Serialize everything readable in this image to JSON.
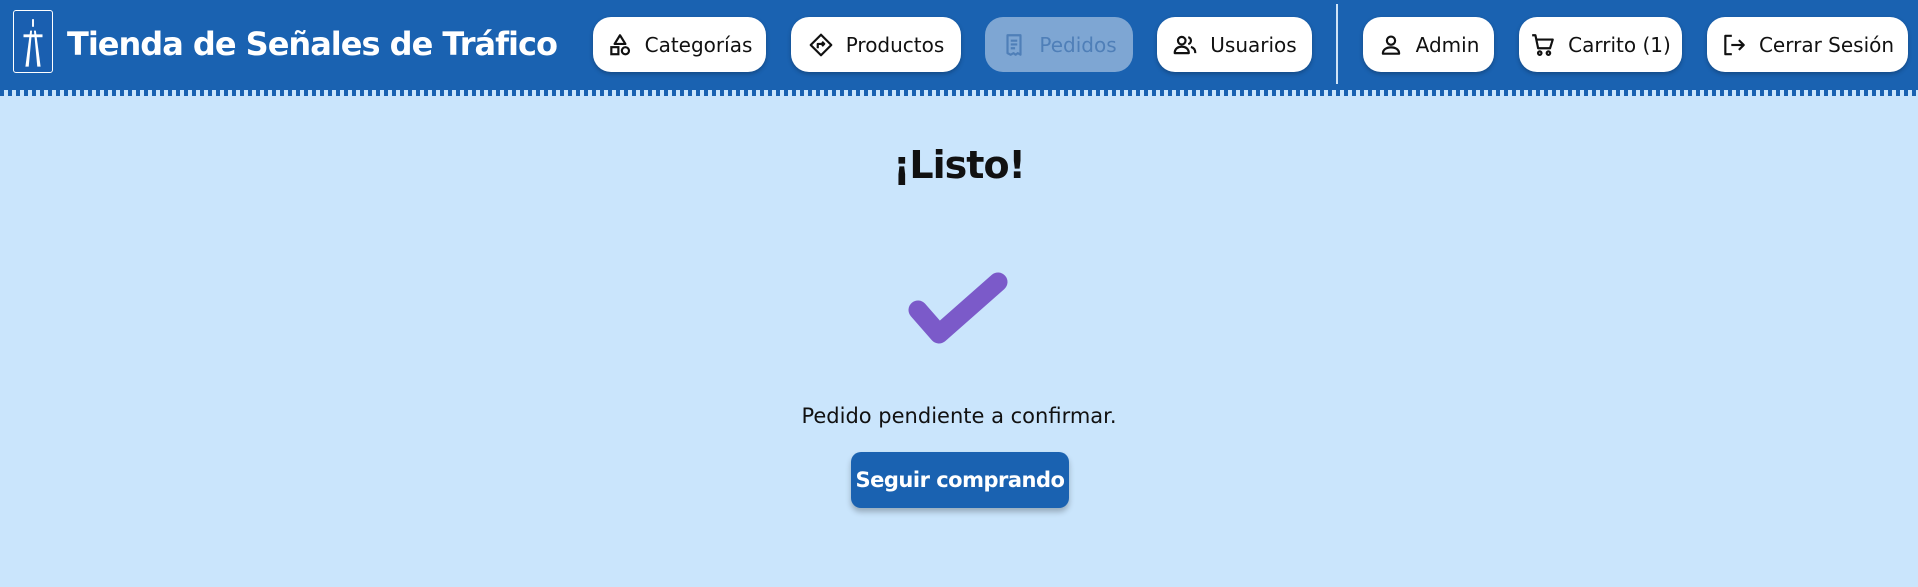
{
  "header": {
    "brand_title": "Tienda de Señales de Tráfico",
    "logo_icon": "motorway-sign-icon",
    "nav": [
      {
        "label": "Categorías",
        "icon": "shapes-icon",
        "state": "enabled"
      },
      {
        "label": "Productos",
        "icon": "direction-sign-icon",
        "state": "enabled"
      },
      {
        "label": "Pedidos",
        "icon": "receipt-icon",
        "state": "disabled"
      },
      {
        "label": "Usuarios",
        "icon": "users-icon",
        "state": "enabled"
      }
    ],
    "account": [
      {
        "label": "Admin",
        "icon": "person-icon"
      },
      {
        "label": "Carrito (1)",
        "icon": "cart-icon"
      },
      {
        "label": "Cerrar Sesión",
        "icon": "logout-icon"
      }
    ]
  },
  "main": {
    "title": "¡Listo!",
    "status_icon": "checkmark-icon",
    "message": "Pedido pendiente a confirmar.",
    "continue_button": "Seguir comprando"
  },
  "colors": {
    "primary": "#1a62b1",
    "background": "#cae5fc",
    "check": "#7b5ac9",
    "disabled_button": "#7ea6d3"
  }
}
